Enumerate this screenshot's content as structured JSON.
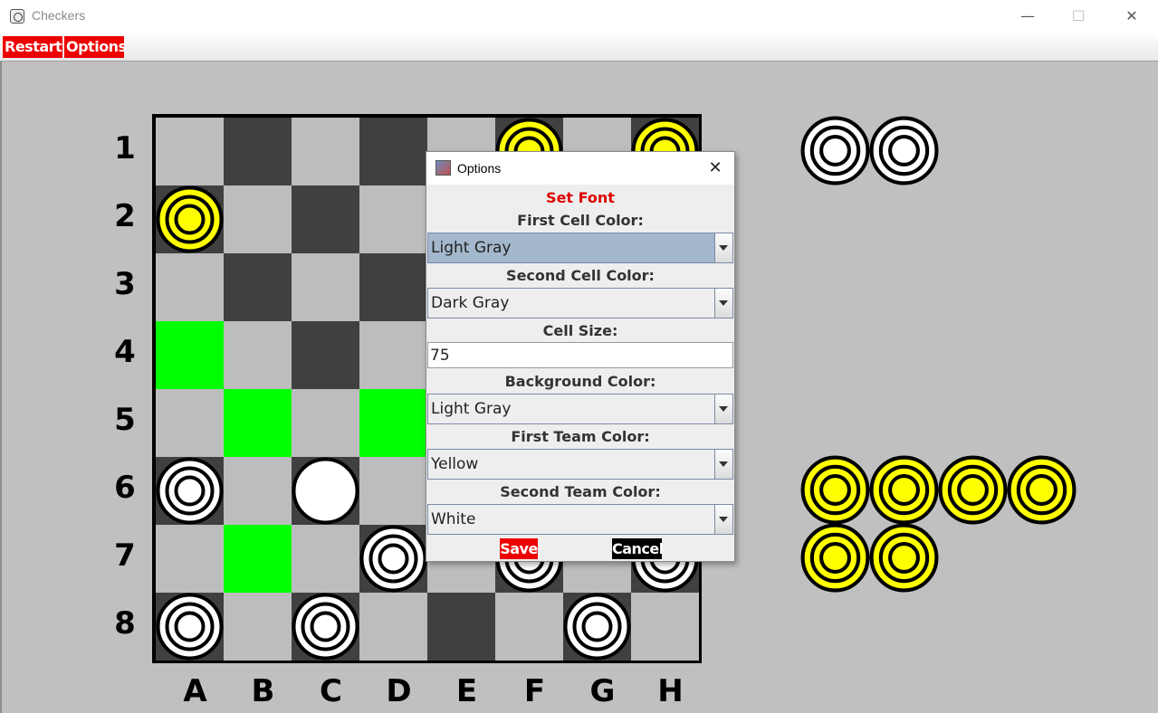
{
  "window": {
    "title": "Checkers",
    "minimize_glyph": "—",
    "maximize_glyph": "☐",
    "close_glyph": "✕"
  },
  "menu": {
    "restart_label": "Restart",
    "options_label": "Options"
  },
  "board": {
    "row_labels": [
      "1",
      "2",
      "3",
      "4",
      "5",
      "6",
      "7",
      "8"
    ],
    "col_labels": [
      "A",
      "B",
      "C",
      "D",
      "E",
      "F",
      "G",
      "H"
    ],
    "highlighted_cells": [
      "A4",
      "B5",
      "D5",
      "B7"
    ],
    "pieces": [
      {
        "cell": "F1",
        "team": "yellow",
        "kind": "man"
      },
      {
        "cell": "H1",
        "team": "yellow",
        "kind": "man"
      },
      {
        "cell": "A2",
        "team": "yellow",
        "kind": "man"
      },
      {
        "cell": "A6",
        "team": "white",
        "kind": "man"
      },
      {
        "cell": "C6",
        "team": "white",
        "kind": "selected"
      },
      {
        "cell": "D7",
        "team": "white",
        "kind": "man"
      },
      {
        "cell": "F7",
        "team": "white",
        "kind": "man"
      },
      {
        "cell": "H7",
        "team": "white",
        "kind": "man"
      },
      {
        "cell": "A8",
        "team": "white",
        "kind": "man"
      },
      {
        "cell": "C8",
        "team": "white",
        "kind": "man"
      },
      {
        "cell": "G8",
        "team": "white",
        "kind": "man"
      }
    ]
  },
  "captured": {
    "white_count": 2,
    "yellow_count": 6
  },
  "colors": {
    "background": "#c0c0c0",
    "first_cell": "#bdbdbd",
    "second_cell": "#404040",
    "highlight": "#00ff00",
    "yellow_team": "#ffff00",
    "white_team": "#ffffff",
    "accent_red": "#ee0000"
  },
  "dialog": {
    "title": "Options",
    "close_glyph": "✕",
    "set_font_label": "Set Font",
    "first_cell_label": "First Cell Color:",
    "first_cell_value": "Light Gray",
    "second_cell_label": "Second Cell Color:",
    "second_cell_value": "Dark Gray",
    "cell_size_label": "Cell Size:",
    "cell_size_value": "75",
    "background_label": "Background Color:",
    "background_value": "Light Gray",
    "first_team_label": "First Team Color:",
    "first_team_value": "Yellow",
    "second_team_label": "Second Team Color:",
    "second_team_value": "White",
    "save_label": "Save",
    "cancel_label": "Cancel"
  }
}
